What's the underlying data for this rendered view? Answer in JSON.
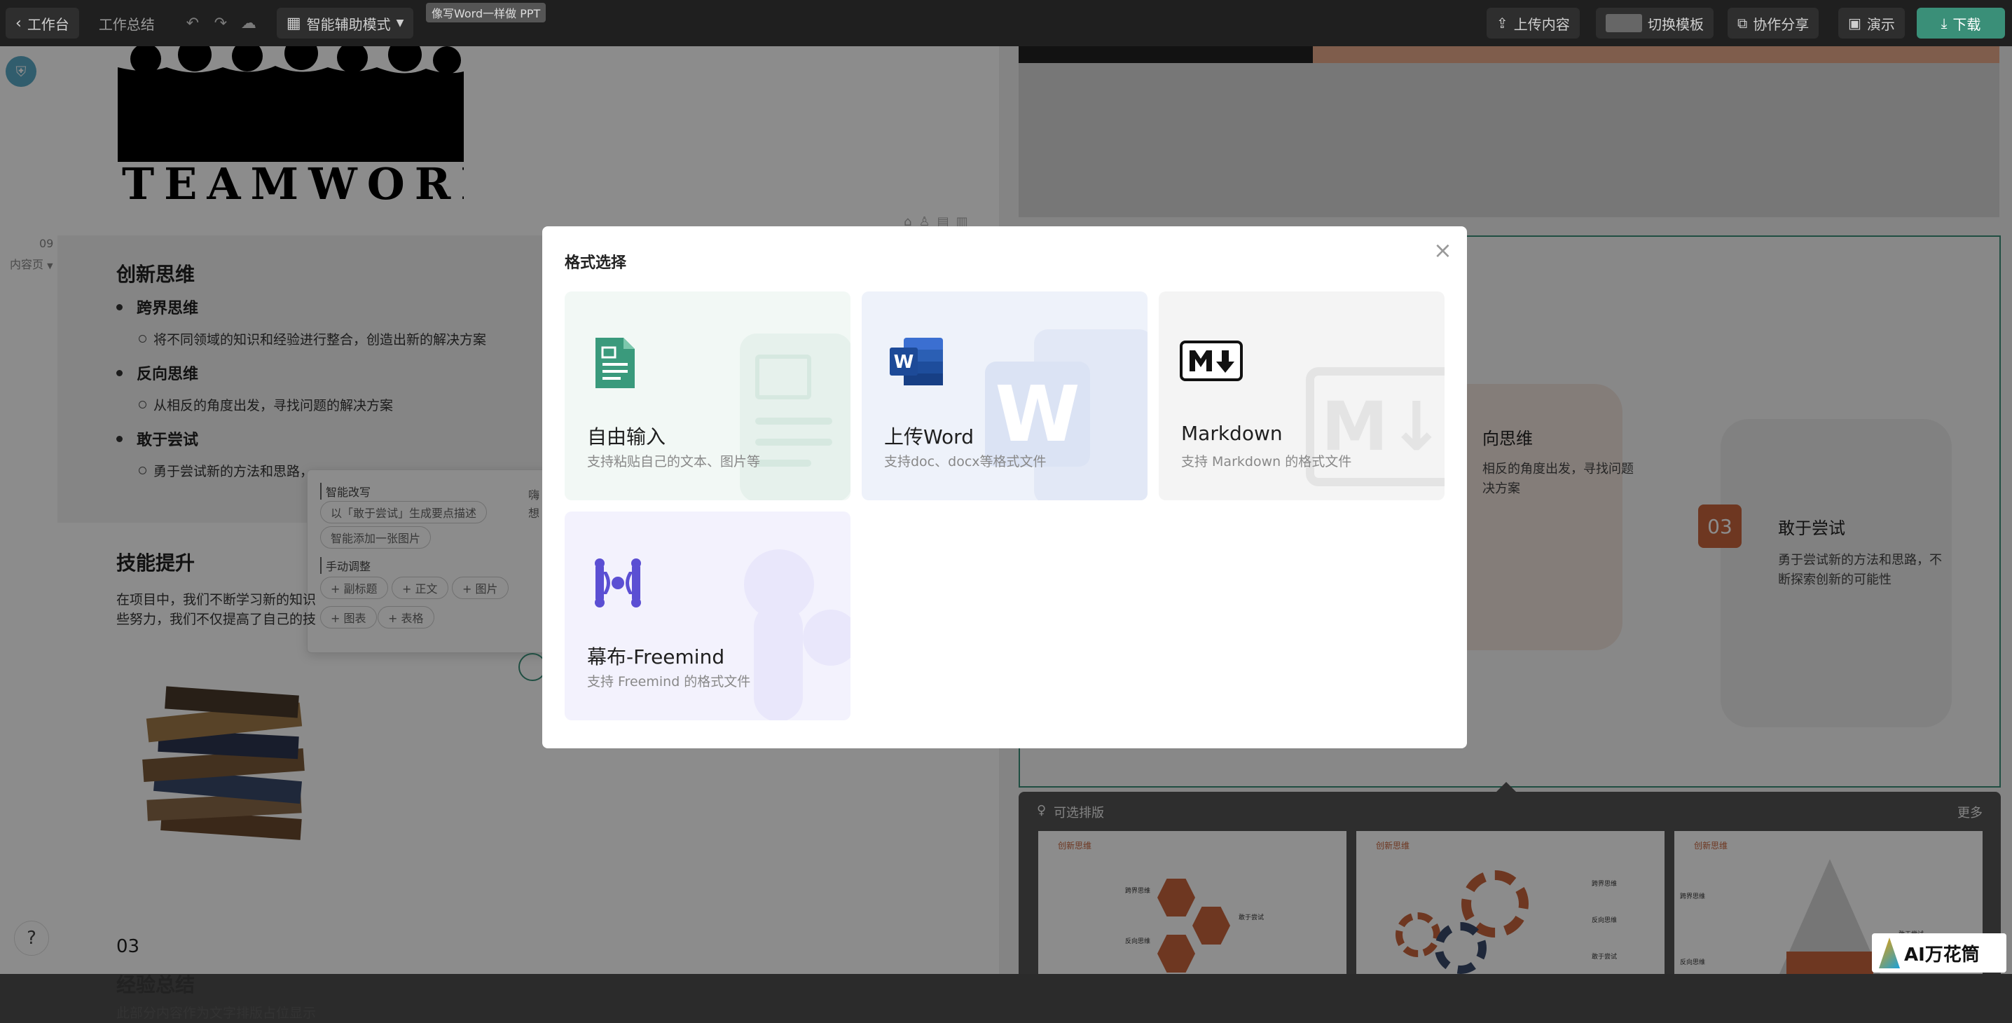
{
  "topbar": {
    "back_label": "工作台",
    "doc_name": "工作总结",
    "mode_label": "智能辅助模式",
    "tooltip": "像写Word一样做 PPT",
    "upload_label": "上传内容",
    "switch_template_label": "切换模板",
    "share_label": "协作分享",
    "present_label": "演示",
    "download_label": "下载"
  },
  "editor": {
    "teamwork_word": "TEAMWORK",
    "page_number": "09",
    "page_type": "内容页",
    "section1": {
      "title": "创新思维",
      "items": [
        {
          "label": "跨界思维",
          "desc": "将不同领域的知识和经验进行整合，创造出新的解决方案"
        },
        {
          "label": "反向思维",
          "desc": "从相反的角度出发，寻找问题的解决方案"
        },
        {
          "label": "敢于尝试",
          "desc": "勇于尝试新的方法和思路，"
        }
      ]
    },
    "smart_menu": {
      "rewrite_heading": "智能改写",
      "rewrite_option": "以「敢于尝试」生成要点描述",
      "add_image_option": "智能添加一张图片",
      "manual_heading": "手动调整",
      "manual_tags": [
        "+ 副标题",
        "+ 正文",
        "+ 图片",
        "+ 图表",
        "+ 表格"
      ],
      "side_text": "嗨\n想"
    },
    "section2": {
      "title": "技能提升",
      "paragraph": "在项目中，我们不断学习新的知识\n些努力，我们不仅提高了自己的技"
    },
    "section3": {
      "number": "03",
      "title": "经验总结",
      "paragraph": "此部分内容作为文字排版占位显示"
    }
  },
  "right": {
    "slide_item2": {
      "title": "向思维",
      "desc": "相反的角度出发，寻找问题\n决方案"
    },
    "slide_item3": {
      "number": "03",
      "title": "敢于尝试",
      "desc": "勇于尝试新的方法和思路，不\n断探索创新的可能性"
    },
    "layouts_panel": {
      "title": "可选排版",
      "more": "更多",
      "thumbs": [
        {
          "title": "创新思维",
          "labels": [
            "跨界思维",
            "反向思维",
            "敢于尝试"
          ]
        },
        {
          "title": "创新思维",
          "labels": [
            "跨界思维",
            "反向思维",
            "敢于尝试"
          ]
        },
        {
          "title": "创新思维",
          "labels": [
            "跨界思维",
            "反向思维",
            "敢于尝试"
          ]
        }
      ]
    }
  },
  "modal": {
    "title": "格式选择",
    "cards": [
      {
        "title": "自由输入",
        "desc": "支持粘贴自己的文本、图片等",
        "icon": "document-icon"
      },
      {
        "title": "上传Word",
        "desc": "支持doc、docx等格式文件",
        "icon": "word-icon"
      },
      {
        "title": "Markdown",
        "desc": "支持 Markdown 的格式文件",
        "icon": "markdown-icon"
      },
      {
        "title": "幕布-Freemind",
        "desc": "支持 Freemind 的格式文件",
        "icon": "mubu-icon"
      }
    ]
  },
  "watermark": "AI万花筒",
  "help_label": "?",
  "colors": {
    "accent": "#3a8f78",
    "orange": "#c8643c",
    "word_blue": "#2b5fb4",
    "doc_green": "#3a9a7c",
    "mubu_purple": "#5b4fd3"
  }
}
